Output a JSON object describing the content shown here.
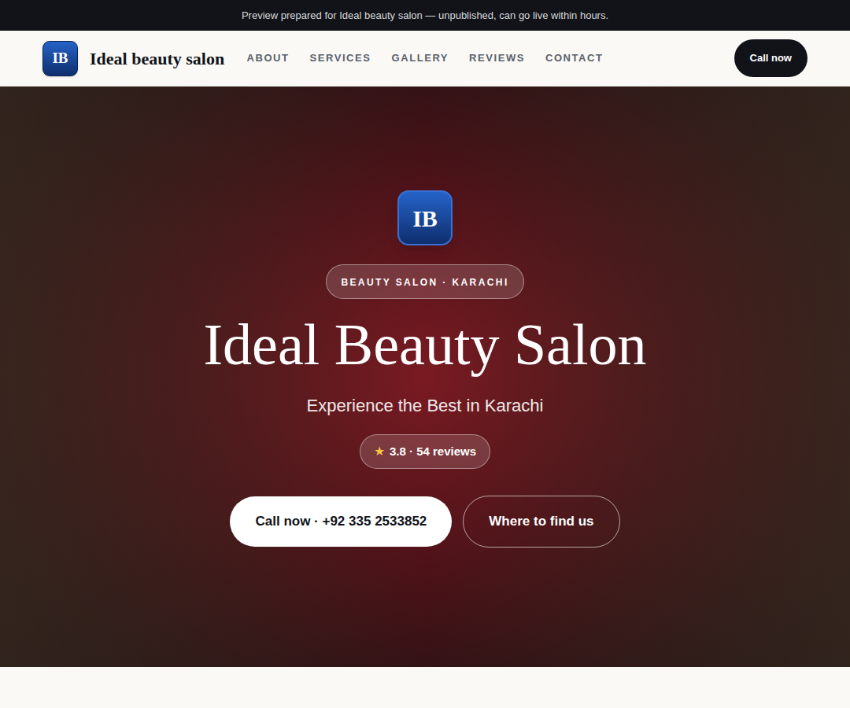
{
  "banner": {
    "text": "Preview prepared for Ideal beauty salon — unpublished, can go live within hours."
  },
  "header": {
    "logo": "IB",
    "brand": "Ideal beauty salon",
    "nav": [
      {
        "label": "ABOUT"
      },
      {
        "label": "SERVICES"
      },
      {
        "label": "GALLERY"
      },
      {
        "label": "REVIEWS"
      },
      {
        "label": "CONTACT"
      }
    ],
    "cta": "Call now"
  },
  "hero": {
    "logo": "IB",
    "badge": "BEAUTY SALON · KARACHI",
    "title": "Ideal Beauty Salon",
    "subtitle": "Experience the Best in Karachi",
    "rating": {
      "star": "★",
      "text": "3.8 · 54 reviews"
    },
    "primary_button": "Call now · +92 335 2533852",
    "secondary_button": "Where to find us"
  }
}
